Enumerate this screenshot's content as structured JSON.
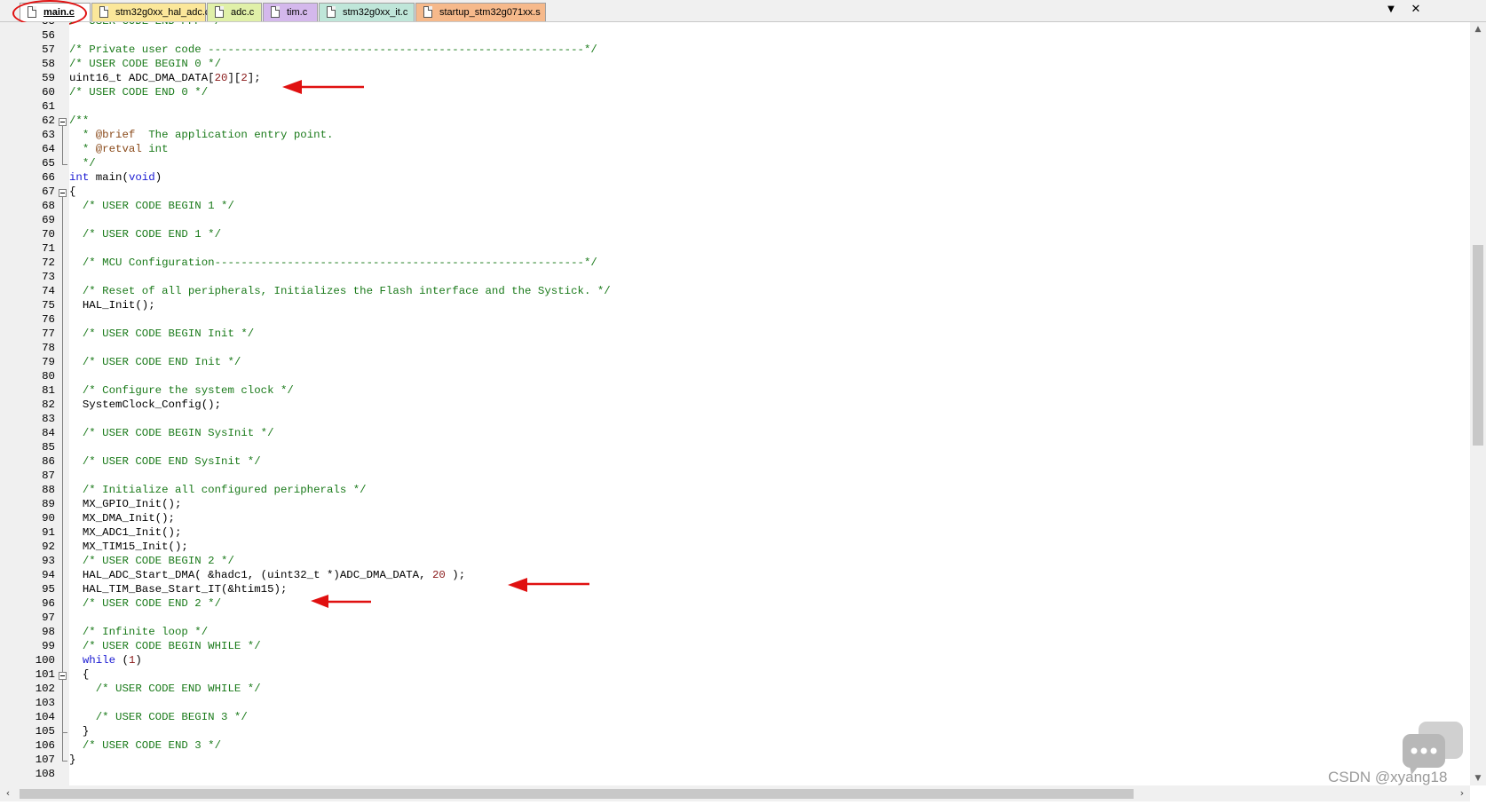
{
  "tabs": [
    {
      "label": "main.c",
      "active": true,
      "color": "#ffffff"
    },
    {
      "label": "stm32g0xx_hal_adc.c",
      "active": false,
      "color": "#fbe79a"
    },
    {
      "label": "adc.c",
      "active": false,
      "color": "#e0f0a8"
    },
    {
      "label": "tim.c",
      "active": false,
      "color": "#d4b8ec"
    },
    {
      "label": "stm32g0xx_it.c",
      "active": false,
      "color": "#bfe6d9"
    },
    {
      "label": "startup_stm32g071xx.s",
      "active": false,
      "color": "#f6b98b"
    }
  ],
  "tab_controls": {
    "dropdown_icon": "▼",
    "close_icon": "✕"
  },
  "first_line_number": 55,
  "lines": [
    [
      [
        "cm",
        "/* USER CODE END PFP */"
      ]
    ],
    [],
    [
      [
        "cm",
        "/* Private user code ---------------------------------------------------------*/"
      ]
    ],
    [
      [
        "cm",
        "/* USER CODE BEGIN 0 */"
      ]
    ],
    [
      [
        "pl",
        "uint16_t ADC_DMA_DATA["
      ],
      [
        "num",
        "20"
      ],
      [
        "pl",
        "]["
      ],
      [
        "num",
        "2"
      ],
      [
        "pl",
        "];"
      ]
    ],
    [
      [
        "cm",
        "/* USER CODE END 0 */"
      ]
    ],
    [],
    [
      [
        "cm",
        "/**"
      ]
    ],
    [
      [
        "cm",
        "  * "
      ],
      [
        "doc",
        "@brief"
      ],
      [
        "cm",
        "  The application entry point."
      ]
    ],
    [
      [
        "cm",
        "  * "
      ],
      [
        "doc",
        "@retval"
      ],
      [
        "cm",
        " int"
      ]
    ],
    [
      [
        "cm",
        "  */"
      ]
    ],
    [
      [
        "kw",
        "int"
      ],
      [
        "pl",
        " main("
      ],
      [
        "kw",
        "void"
      ],
      [
        "pl",
        ")"
      ]
    ],
    [
      [
        "pl",
        "{"
      ]
    ],
    [
      [
        "cm",
        "  /* USER CODE BEGIN 1 */"
      ]
    ],
    [],
    [
      [
        "cm",
        "  /* USER CODE END 1 */"
      ]
    ],
    [],
    [
      [
        "cm",
        "  /* MCU Configuration--------------------------------------------------------*/"
      ]
    ],
    [],
    [
      [
        "cm",
        "  /* Reset of all peripherals, Initializes the Flash interface and the Systick. */"
      ]
    ],
    [
      [
        "pl",
        "  HAL_Init();"
      ]
    ],
    [],
    [
      [
        "cm",
        "  /* USER CODE BEGIN Init */"
      ]
    ],
    [],
    [
      [
        "cm",
        "  /* USER CODE END Init */"
      ]
    ],
    [],
    [
      [
        "cm",
        "  /* Configure the system clock */"
      ]
    ],
    [
      [
        "pl",
        "  SystemClock_Config();"
      ]
    ],
    [],
    [
      [
        "cm",
        "  /* USER CODE BEGIN SysInit */"
      ]
    ],
    [],
    [
      [
        "cm",
        "  /* USER CODE END SysInit */"
      ]
    ],
    [],
    [
      [
        "cm",
        "  /* Initialize all configured peripherals */"
      ]
    ],
    [
      [
        "pl",
        "  MX_GPIO_Init();"
      ]
    ],
    [
      [
        "pl",
        "  MX_DMA_Init();"
      ]
    ],
    [
      [
        "pl",
        "  MX_ADC1_Init();"
      ]
    ],
    [
      [
        "pl",
        "  MX_TIM15_Init();"
      ]
    ],
    [
      [
        "cm",
        "  /* USER CODE BEGIN 2 */"
      ]
    ],
    [
      [
        "pl",
        "  HAL_ADC_Start_DMA( &hadc1, (uint32_t *)ADC_DMA_DATA, "
      ],
      [
        "num",
        "20"
      ],
      [
        "pl",
        " );"
      ]
    ],
    [
      [
        "pl",
        "  HAL_TIM_Base_Start_IT(&htim15);"
      ]
    ],
    [
      [
        "cm",
        "  /* USER CODE END 2 */"
      ]
    ],
    [],
    [
      [
        "cm",
        "  /* Infinite loop */"
      ]
    ],
    [
      [
        "cm",
        "  /* USER CODE BEGIN WHILE */"
      ]
    ],
    [
      [
        "pl",
        "  "
      ],
      [
        "kw",
        "while"
      ],
      [
        "pl",
        " ("
      ],
      [
        "num",
        "1"
      ],
      [
        "pl",
        ")"
      ]
    ],
    [
      [
        "pl",
        "  {"
      ]
    ],
    [
      [
        "cm",
        "    /* USER CODE END WHILE */"
      ]
    ],
    [],
    [
      [
        "cm",
        "    /* USER CODE BEGIN 3 */"
      ]
    ],
    [
      [
        "pl",
        "  }"
      ]
    ],
    [
      [
        "cm",
        "  /* USER CODE END 3 */"
      ]
    ],
    [
      [
        "pl",
        "}"
      ]
    ],
    []
  ],
  "watermark": "CSDN @xyang18"
}
